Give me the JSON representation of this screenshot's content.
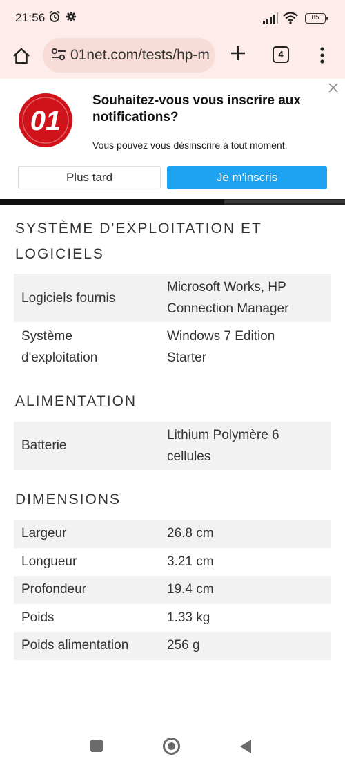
{
  "status_bar": {
    "time": "21:56",
    "battery": "85",
    "icons": [
      "alarm-icon",
      "settings-icon",
      "signal-icon",
      "wifi-icon",
      "battery-icon"
    ]
  },
  "browser": {
    "url": "01net.com/tests/hp-m",
    "tab_count": "4",
    "icons": [
      "home-icon",
      "site-info-icon",
      "new-tab-icon",
      "tabs-icon",
      "menu-icon"
    ]
  },
  "notification": {
    "logo_text": "01",
    "title": "Souhaitez-vous vous inscrire aux notifications?",
    "subtitle": "Vous pouvez vous désinscrire à tout moment.",
    "later_label": "Plus tard",
    "signup_label": "Je m'inscris",
    "accent_color": "#1ea3f0",
    "logo_color": "#d0121b"
  },
  "sections": [
    {
      "title_line1": "SYSTÈME D'EXPLOITATION ET",
      "title_line2": "LOGICIELS",
      "rows": [
        {
          "label": "Logiciels fournis",
          "value_line1": "Microsoft Works, HP",
          "value_line2": "Connection Manager"
        },
        {
          "label_line1": "Système",
          "label_line2": "d'exploitation",
          "value_line1": "Windows 7 Edition",
          "value_line2": "Starter"
        }
      ]
    },
    {
      "title": "ALIMENTATION",
      "rows": [
        {
          "label": "Batterie",
          "value_line1": "Lithium Polymère 6",
          "value_line2": "cellules"
        }
      ]
    },
    {
      "title": "DIMENSIONS",
      "rows": [
        {
          "label": "Largeur",
          "value": "26.8 cm"
        },
        {
          "label": "Longueur",
          "value": "3.21 cm"
        },
        {
          "label": "Profondeur",
          "value": "19.4 cm"
        },
        {
          "label": "Poids",
          "value": "1.33 kg"
        },
        {
          "label": "Poids alimentation",
          "value": "256 g"
        }
      ]
    }
  ]
}
